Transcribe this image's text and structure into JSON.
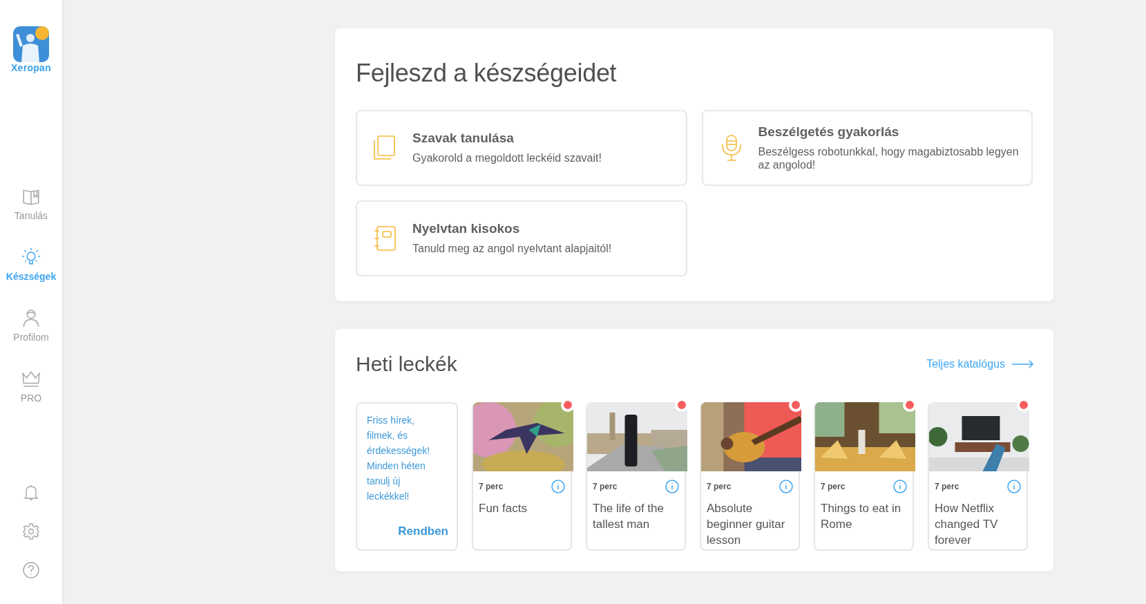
{
  "sidebar": {
    "logo": "Xeropan",
    "items": [
      {
        "label": "Tanulás",
        "selected": false
      },
      {
        "label": "Készségek",
        "selected": true
      },
      {
        "label": "Profilom",
        "selected": false
      },
      {
        "label": "PRO",
        "selected": false
      }
    ]
  },
  "skills": {
    "title": "Fejleszd a készségeidet",
    "cards": [
      {
        "title": "Szavak tanulása",
        "text": "Gyakorold a megoldott leckéid szavait!"
      },
      {
        "title": "Beszélgetés gyakorlás",
        "text": "Beszélgess robotunkkal, hogy magabiztosabb legyen az angolod!"
      },
      {
        "title": "Nyelvtan kisokos",
        "text": "Tanuld meg az angol nyelvtant alapjaitól!"
      }
    ]
  },
  "weekly": {
    "title": "Heti leckék",
    "link": "Teljes katalógus",
    "intro": {
      "text": "Friss hírek, filmek, és érdekességek! Minden héten tanulj új leckékkel!",
      "button": "Rendben"
    },
    "lessons": [
      {
        "duration": "7 perc",
        "title": "Fun facts",
        "new": true
      },
      {
        "duration": "7 perc",
        "title": "The life of the tallest man",
        "new": true
      },
      {
        "duration": "7 perc",
        "title": "Absolute beginner guitar lesson",
        "new": true
      },
      {
        "duration": "7 perc",
        "title": "Things to eat in Rome",
        "new": true
      },
      {
        "duration": "7 perc",
        "title": "How Netflix changed TV forever",
        "new": true
      }
    ]
  }
}
